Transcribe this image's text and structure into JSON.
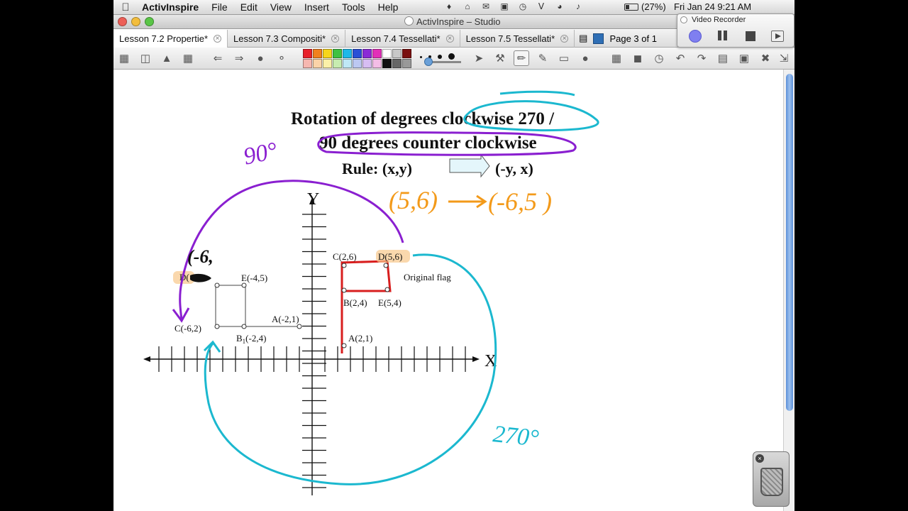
{
  "menubar": {
    "app_name": "ActivInspire",
    "items": [
      "File",
      "Edit",
      "View",
      "Insert",
      "Tools",
      "Help"
    ],
    "battery": "(27%)",
    "clock": "Fri Jan 24  9:21 AM"
  },
  "window": {
    "title": "ActivInspire – Studio"
  },
  "tabs": [
    {
      "label": "Lesson 7.2 Propertie*",
      "active": true
    },
    {
      "label": "Lesson 7.3 Compositi*",
      "active": false
    },
    {
      "label": "Lesson 7.4 Tessellati*",
      "active": false
    },
    {
      "label": "Lesson 7.5 Tessellati*",
      "active": false
    }
  ],
  "page_indicator": "Page 3 of 1",
  "palette": [
    "#e8202a",
    "#f0801d",
    "#f6d51b",
    "#3ec142",
    "#1db8e8",
    "#2a4fd6",
    "#8a2ad6",
    "#e230b8",
    "#ffffff",
    "#c8c8c8",
    "#7a1010",
    "#f6b7b0",
    "#fbd3a8",
    "#fbf0a8",
    "#c7ecb0",
    "#bfe8f6",
    "#bcc8f2",
    "#d6bdf2",
    "#f4bde6",
    "#111111",
    "#666666",
    "#999999"
  ],
  "recorder": {
    "title": "Video Recorder"
  },
  "slide": {
    "title_line1_a": "Rotation of degrees ",
    "title_line1_b": "clockwise  270 /",
    "title_line2": "90 degrees counter clockwise",
    "rule_label": "Rule: (x,y)",
    "rule_result": "(-y, x)",
    "axis_x": "X",
    "axis_y": "Y",
    "original_label": "Original flag",
    "points": {
      "C_orig": "C(2,6)",
      "D_orig": "D(5,6)",
      "B_orig": "B(2,4)",
      "E_orig": "E(5,4)",
      "A_orig": "A(2,1)",
      "E_rot": "E(-4,5)",
      "A_rot": "A(-2,1)",
      "C_rot": "C(-6,2)",
      "B_rot": "B",
      "B_rot_sub": "1",
      "B_rot_coord": "(-2,4)",
      "D_rot": "D("
    },
    "handwriting": {
      "deg90": "90°",
      "deg270": "270°",
      "example_in": "(5,6)",
      "example_out": "(-6,5 )",
      "partial": "(-6,"
    },
    "colors": {
      "purple": "#8a1fd0",
      "cyan": "#1bb8cf",
      "orange": "#f39a1a",
      "red": "#d81e1e",
      "highlight": "#f8c88a"
    }
  }
}
